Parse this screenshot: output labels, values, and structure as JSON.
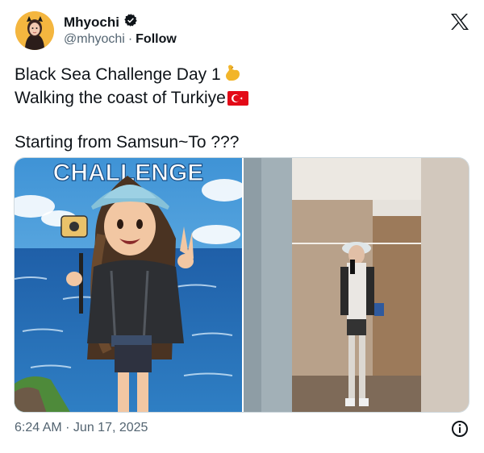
{
  "author": {
    "display_name": "Mhyochi",
    "handle": "@mhyochi",
    "separator": "·",
    "follow_label": "Follow"
  },
  "tweet": {
    "line1": "Black Sea Challenge Day 1",
    "line2": "Walking the coast of Turkiye",
    "line3": "Starting from Samsun~To ???"
  },
  "media": {
    "left_image_text": "CHALLENGE"
  },
  "timestamp": "6:24 AM · Jun 17, 2025",
  "icons": [
    "verified-icon",
    "x-logo-icon",
    "flexed-biceps-emoji",
    "turkey-flag-emoji",
    "info-icon"
  ],
  "colors": {
    "accent": "#f4b63f",
    "text": "#0f1419",
    "muted": "#536471"
  }
}
